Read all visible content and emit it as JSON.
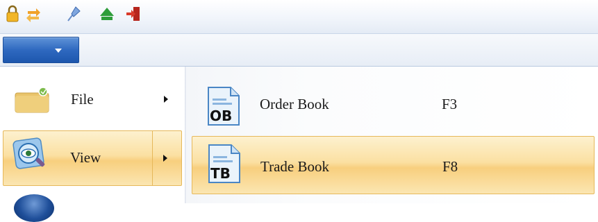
{
  "quick_access_toolbar": {
    "icons": [
      "lock-icon",
      "refresh-icon",
      "pin-icon",
      "upload-icon",
      "exit-icon"
    ]
  },
  "app_menu_button": {
    "icon": "chevron-down-icon"
  },
  "main_menu": {
    "items": [
      {
        "label": "File",
        "icon": "folder-icon",
        "has_submenu": true,
        "selected": false
      },
      {
        "label": "View",
        "icon": "view-eye-icon",
        "has_submenu": true,
        "selected": true
      },
      {
        "label": "",
        "icon": "globe-icon",
        "has_submenu": false,
        "selected": false
      }
    ]
  },
  "submenu": {
    "items": [
      {
        "label": "Order Book",
        "shortcut": "F3",
        "icon_text": "OB",
        "selected": false
      },
      {
        "label": "Trade Book",
        "shortcut": "F8",
        "icon_text": "TB",
        "selected": true
      }
    ]
  },
  "colors": {
    "highlight": "#fbe0a2",
    "highlight_border": "#e6b85a",
    "app_button": "#2f69c0"
  }
}
